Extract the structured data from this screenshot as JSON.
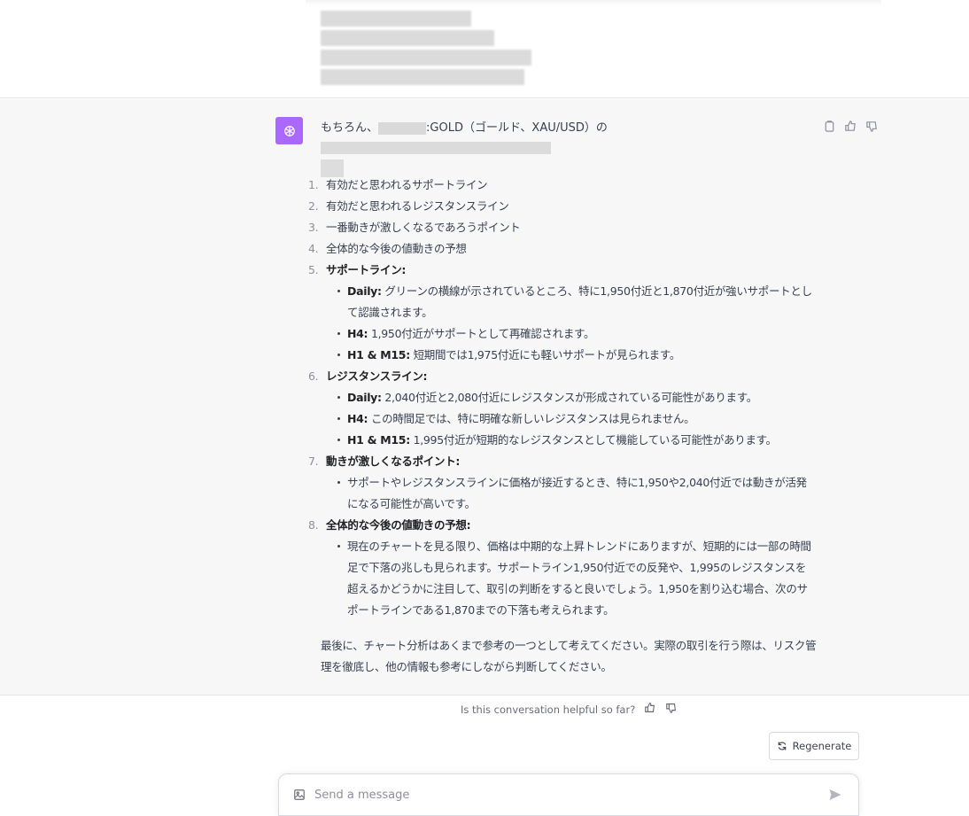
{
  "intro": {
    "prefix": "もちろん、",
    "middle": ":GOLD（ゴールド、XAU/USD）の"
  },
  "outline": [
    {
      "num": "1.",
      "label": "有効だと思われるサポートライン"
    },
    {
      "num": "2.",
      "label": "有効だと思われるレジスタンスライン"
    },
    {
      "num": "3.",
      "label": "一番動きが激しくなるであろうポイント"
    },
    {
      "num": "4.",
      "label": "全体的な今後の値動きの予想"
    }
  ],
  "sections": [
    {
      "num": "5.",
      "title": "サポートライン:",
      "items": [
        {
          "label": "Daily:",
          "text": " グリーンの横線が示されているところ、特に1,950付近と1,870付近が強いサポートとして認識されます。"
        },
        {
          "label": "H4:",
          "text": " 1,950付近がサポートとして再確認されます。"
        },
        {
          "label": "H1 & M15:",
          "text": " 短期間では1,975付近にも軽いサポートが見られます。"
        }
      ]
    },
    {
      "num": "6.",
      "title": "レジスタンスライン:",
      "items": [
        {
          "label": "Daily:",
          "text": " 2,040付近と2,080付近にレジスタンスが形成されている可能性があります。"
        },
        {
          "label": "H4:",
          "text": " この時間足では、特に明確な新しいレジスタンスは見られません。"
        },
        {
          "label": "H1 & M15:",
          "text": " 1,995付近が短期的なレジスタンスとして機能している可能性があります。"
        }
      ]
    },
    {
      "num": "7.",
      "title": "動きが激しくなるポイント:",
      "items": [
        {
          "label": "",
          "text": "サポートやレジスタンスラインに価格が接近するとき、特に1,950や2,040付近では動きが活発になる可能性が高いです。"
        }
      ]
    },
    {
      "num": "8.",
      "title": "全体的な今後の値動きの予想:",
      "items": [
        {
          "label": "",
          "text": "現在のチャートを見る限り、価格は中期的な上昇トレンドにありますが、短期的には一部の時間足で下落の兆しも見られます。サポートライン1,950付近での反発や、1,995のレジスタンスを超えるかどうかに注目して、取引の判断をすると良いでしょう。1,950を割り込む場合、次のサポートラインである1,870までの下落も考えられます。"
        }
      ]
    }
  ],
  "closing": "最後に、チャート分析はあくまで参考の一つとして考えてください。実際の取引を行う際は、リスク管理を徹底し、他の情報も参考にしながら判断してください。",
  "feedback": {
    "question": "Is this conversation helpful so far?"
  },
  "regenerate_label": "Regenerate",
  "composer": {
    "placeholder": "Send a message"
  },
  "icons": {
    "avatar": "openai-logo-icon",
    "copy": "clipboard-icon",
    "like": "thumbs-up-icon",
    "dislike": "thumbs-down-icon",
    "regenerate": "refresh-icon",
    "attach": "image-icon",
    "send": "send-icon"
  },
  "colors": {
    "accent_avatar": "#ab68ff",
    "assistant_bg": "#f7f7f8"
  }
}
